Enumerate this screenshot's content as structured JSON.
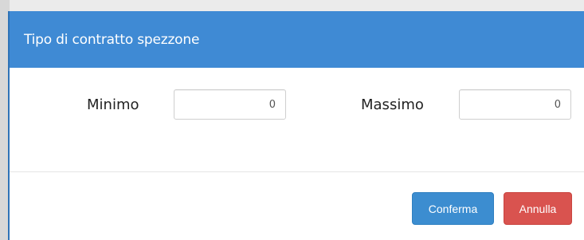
{
  "modal": {
    "title": "Tipo di contratto spezzone"
  },
  "fields": {
    "min_label": "Minimo",
    "min_value": "0",
    "max_label": "Massimo",
    "max_value": "0"
  },
  "buttons": {
    "confirm": "Conferma",
    "cancel": "Annulla"
  },
  "colors": {
    "header": "#3f8ad4",
    "confirm": "#3c8dd0",
    "cancel": "#d9534f"
  }
}
